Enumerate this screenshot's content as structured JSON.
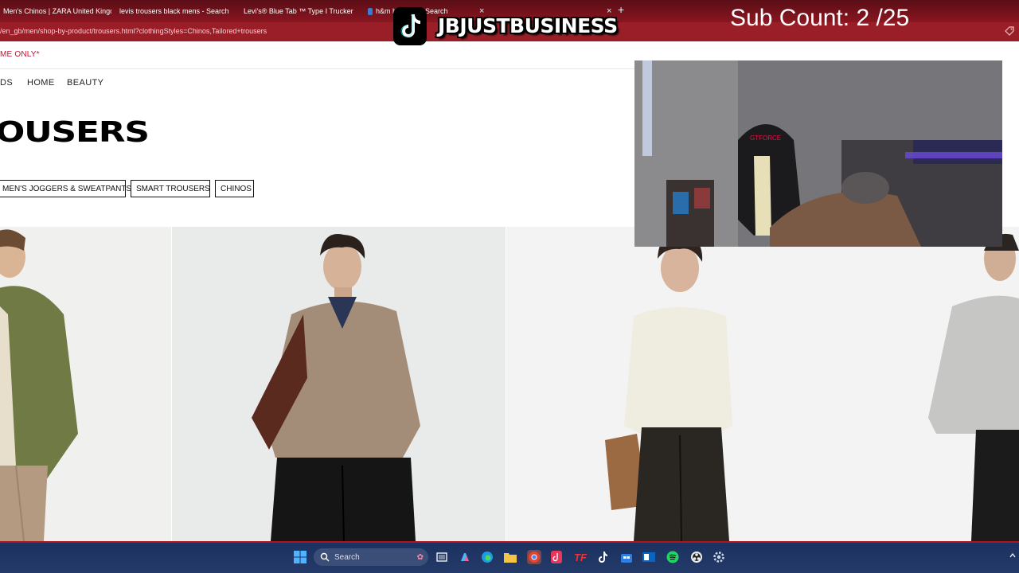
{
  "browser": {
    "tabs": [
      {
        "title": "Men's Chinos | ZARA United Kingdom",
        "icon_color": "#111111",
        "active": false
      },
      {
        "title": "levis trousers black mens - Search",
        "icon_color": "#3b7bd6",
        "active": false
      },
      {
        "title": "Levi's® Blue Tab ™ Type I Trucker",
        "icon_color": "#c8102e",
        "active": false
      },
      {
        "title": "h&m h",
        "icon_color": "#3b7bd6",
        "active": false
      },
      {
        "title": "Search",
        "icon_color": "#3b7bd6",
        "active": false
      }
    ],
    "url": "/en_gb/men/shop-by-product/trousers.html?clothingStyles=Chinos,Tailored+trousers"
  },
  "page": {
    "promo": "ME ONLY*",
    "nav": [
      "DS",
      "HOME",
      "BEAUTY"
    ],
    "title": "OUSERS",
    "chips": [
      "MEN'S JOGGERS & SWEATPANTS",
      "SMART TROUSERS",
      "CHINOS"
    ]
  },
  "overlay": {
    "brand": "JBJUSTBUSINESS",
    "sub_count": "Sub Count: 2 /25"
  },
  "taskbar": {
    "search_label": "Search",
    "apps": [
      "start-icon",
      "search-box",
      "task-view-icon",
      "copilot-icon",
      "edge-icon",
      "file-explorer-icon",
      "chrome-icon",
      "tiktok-studio-icon",
      "tf-icon",
      "tiktok-icon",
      "store-icon",
      "outlook-icon",
      "spotify-icon",
      "obs-icon",
      "settings-icon"
    ]
  },
  "colors": {
    "browser_frame": "#8a1620",
    "accent_red": "#c8102e",
    "taskbar": "#1b3160"
  }
}
